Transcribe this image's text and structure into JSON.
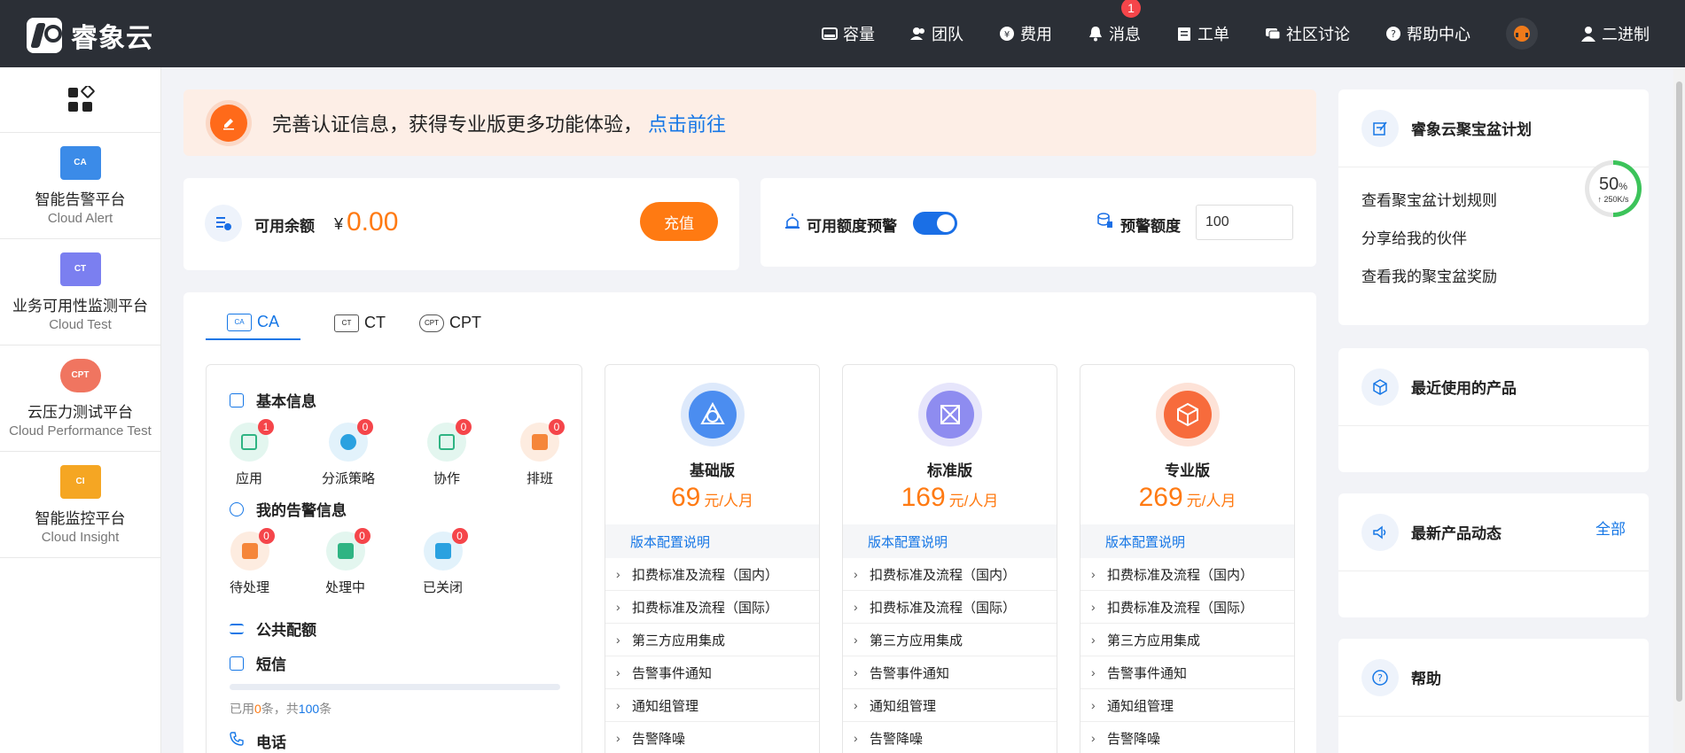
{
  "brand": {
    "name": "睿象云"
  },
  "nav": [
    {
      "label": "容量",
      "icon": "drive-icon"
    },
    {
      "label": "团队",
      "icon": "team-icon"
    },
    {
      "label": "费用",
      "icon": "yen-icon"
    },
    {
      "label": "消息",
      "icon": "bell-icon",
      "badge": "1"
    },
    {
      "label": "工单",
      "icon": "ticket-icon"
    },
    {
      "label": "社区讨论",
      "icon": "chat-icon"
    },
    {
      "label": "帮助中心",
      "icon": "help-icon"
    },
    {
      "label": "二进制",
      "icon": "user-icon"
    }
  ],
  "sidebar": [
    {
      "zh": "智能告警平台",
      "en": "Cloud Alert",
      "tag": "CA",
      "color": "#3b8be8"
    },
    {
      "zh": "业务可用性监测平台",
      "en": "Cloud Test",
      "tag": "CT",
      "color": "#7b7ff0"
    },
    {
      "zh": "云压力测试平台",
      "en": "Cloud Performance Test",
      "tag": "CPT",
      "color": "#f07560"
    },
    {
      "zh": "智能监控平台",
      "en": "Cloud Insight",
      "tag": "CI",
      "color": "#f5a623"
    }
  ],
  "notice": {
    "text": "完善认证信息，获得专业版更多功能体验，",
    "link": "点击前往"
  },
  "balance": {
    "label": "可用余额",
    "currency": "¥",
    "amount": "0.00",
    "button": "充值"
  },
  "warning": {
    "label": "可用额度预警",
    "quota_label": "预警额度",
    "quota_value": "100",
    "enabled": true
  },
  "tabs": [
    "CA",
    "CT",
    "CPT"
  ],
  "basic": {
    "title": "基本信息",
    "items": [
      {
        "label": "应用",
        "count": "1"
      },
      {
        "label": "分派策略",
        "count": "0"
      },
      {
        "label": "协作",
        "count": "0"
      },
      {
        "label": "排班",
        "count": "0"
      }
    ]
  },
  "my_alerts": {
    "title": "我的告警信息",
    "items": [
      {
        "label": "待处理",
        "count": "0"
      },
      {
        "label": "处理中",
        "count": "0"
      },
      {
        "label": "已关闭",
        "count": "0"
      }
    ]
  },
  "quota": {
    "title": "公共配额",
    "sms_title": "短信",
    "usage_prefix": "已用",
    "used": "0",
    "usage_mid": "条，共",
    "total": "100",
    "usage_suffix": "条",
    "used_fraction": 0,
    "phone_title": "电话"
  },
  "plans": [
    {
      "name": "基础版",
      "price": "69",
      "unit": "元/人月"
    },
    {
      "name": "标准版",
      "price": "169",
      "unit": "元/人月"
    },
    {
      "name": "专业版",
      "price": "269",
      "unit": "元/人月"
    }
  ],
  "plan_config_label": "版本配置说明",
  "plan_features": [
    "扣费标准及流程（国内）",
    "扣费标准及流程（国际）",
    "第三方应用集成",
    "告警事件通知",
    "通知组管理",
    "告警降噪"
  ],
  "right": {
    "treasure": {
      "title": "睿象云聚宝盆计划",
      "links": [
        "查看聚宝盆计划规则",
        "分享给我的伙伴",
        "查看我的聚宝盆奖励"
      ]
    },
    "recent": {
      "title": "最近使用的产品"
    },
    "news": {
      "title": "最新产品动态",
      "more": "全部"
    },
    "help": {
      "title": "帮助"
    }
  },
  "net_widget": {
    "percent": "50",
    "unit": "%",
    "speed": "↑ 250K/s"
  }
}
